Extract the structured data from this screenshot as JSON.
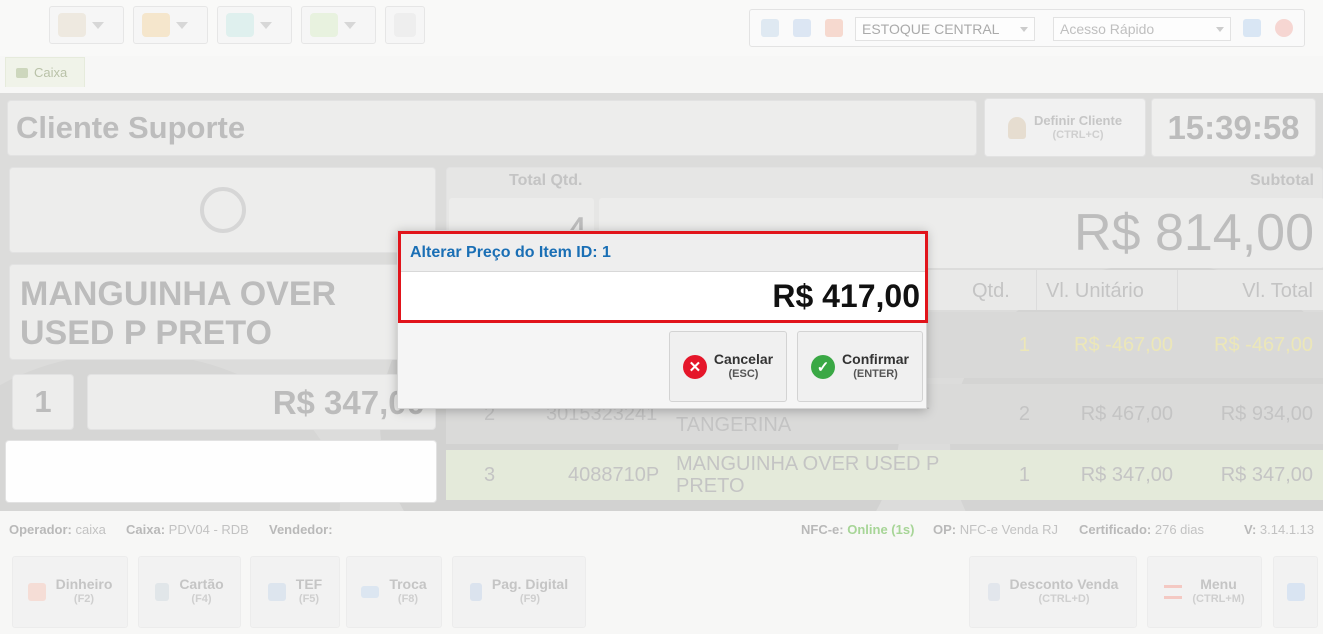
{
  "toolbar": {
    "stock_select": "ESTOQUE CENTRAL",
    "quick_access_placeholder": "Acesso Rápido",
    "tab_label": "Caixa"
  },
  "header": {
    "client_name": "Cliente Suporte",
    "define_client_label": "Definir Cliente",
    "define_client_shortcut": "(CTRL+C)",
    "clock": "15:39:58"
  },
  "product": {
    "name": "MANGUINHA OVER USED P PRETO",
    "qty": "1",
    "price": "R$ 347,00"
  },
  "totals": {
    "qty_label": "Total Qtd.",
    "qty_value": "4",
    "subtotal_label": "Subtotal",
    "subtotal_value": "R$ 814,00"
  },
  "table": {
    "columns": [
      "Qtd.",
      "Vl. Unitário",
      "Vl. Total"
    ],
    "rows": [
      {
        "n": "",
        "code": "",
        "desc": "",
        "qty": "1",
        "unit": "R$ -467,00",
        "total": "R$ -467,00"
      },
      {
        "n": "2",
        "code": "3015323241",
        "desc": "ARPOADOR SOFT FEM. 41 TANGERINA",
        "qty": "2",
        "unit": "R$ 467,00",
        "total": "R$ 934,00"
      },
      {
        "n": "3",
        "code": "4088710P",
        "desc": "MANGUINHA OVER USED P PRETO",
        "qty": "1",
        "unit": "R$ 347,00",
        "total": "R$ 347,00"
      }
    ]
  },
  "status": {
    "operator_label": "Operador:",
    "operator_value": "caixa",
    "cashier_label": "Caixa:",
    "cashier_value": "PDV04 - RDB",
    "seller_label": "Vendedor:",
    "nfce_label": "NFC-e:",
    "nfce_value": "Online (1s)",
    "op_label": "OP:",
    "op_value": "NFC-e Venda RJ",
    "cert_label": "Certificado:",
    "cert_value": "276 dias",
    "version_label": "V:",
    "version_value": "3.14.1.13"
  },
  "footer_buttons": [
    {
      "label": "Dinheiro",
      "shortcut": "(F2)"
    },
    {
      "label": "Cartão",
      "shortcut": "(F4)"
    },
    {
      "label": "TEF",
      "shortcut": "(F5)"
    },
    {
      "label": "Troca",
      "shortcut": "(F8)"
    },
    {
      "label": "Pag. Digital",
      "shortcut": "(F9)"
    },
    {
      "label": "Desconto Venda",
      "shortcut": "(CTRL+D)"
    },
    {
      "label": "Menu",
      "shortcut": "(CTRL+M)"
    }
  ],
  "dialog": {
    "title": "Alterar Preço do Item ID: 1",
    "value": "R$ 417,00",
    "cancel_label": "Cancelar",
    "cancel_shortcut": "(ESC)",
    "confirm_label": "Confirmar",
    "confirm_shortcut": "(ENTER)"
  },
  "colors": {
    "title_blue": "#1a6fb5",
    "highlight_red": "#e1141b",
    "online_green": "#9bd08a"
  }
}
